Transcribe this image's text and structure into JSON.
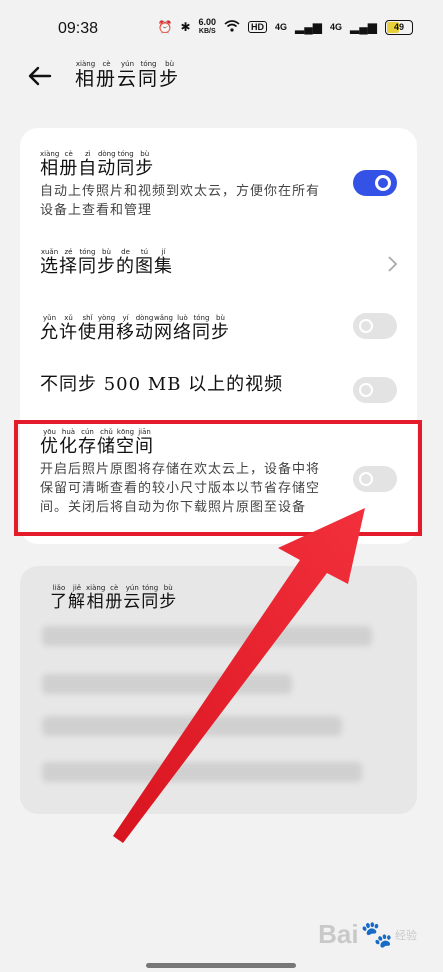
{
  "status": {
    "time": "09:38",
    "alarm_icon": "alarm-icon",
    "bluetooth_icon": "bluetooth-icon",
    "net_speed_value": "6.00",
    "net_speed_unit": "KB/S",
    "wifi_icon": "wifi-icon",
    "hd_badge": "HD",
    "signal1_label": "4G",
    "signal2_label": "4G",
    "battery_level": "49",
    "battery_fraction": 0.49
  },
  "header": {
    "back_icon": "arrow-left-icon",
    "title": "相册云同步",
    "title_pinyin": [
      "xiàng",
      "cè",
      "yún",
      "tóng",
      "bù"
    ]
  },
  "settings": [
    {
      "id": "album-auto-sync",
      "title": "相册自动同步",
      "title_pinyin": [
        "xiàng",
        "cè",
        "zì",
        "dòng",
        "tóng",
        "bù"
      ],
      "desc": "自动上传照片和视频到欢太云，方便你在所有设备上查看和管理",
      "control": "toggle",
      "on": true
    },
    {
      "id": "select-albums",
      "title": "选择同步的图集",
      "title_pinyin": [
        "xuǎn",
        "zé",
        "tóng",
        "bù",
        "de",
        "tú",
        "jí"
      ],
      "control": "chevron"
    },
    {
      "id": "mobile-data-sync",
      "title": "允许使用移动网络同步",
      "title_pinyin": [
        "yǔn",
        "xǔ",
        "shǐ",
        "yòng",
        "yí",
        "dòng",
        "wǎng",
        "luò",
        "tóng",
        "bù"
      ],
      "control": "toggle",
      "on": false
    },
    {
      "id": "skip-large-videos",
      "title": "不同步 500 MB 以上的视频",
      "control": "toggle",
      "on": false
    },
    {
      "id": "optimize-storage",
      "title": "优化存储空间",
      "title_pinyin": [
        "yōu",
        "huà",
        "cún",
        "chǔ",
        "kōng",
        "jiān"
      ],
      "desc": "开启后照片原图将存储在欢太云上，设备中将保留可清晰查看的较小尺寸版本以节省存储空间。关闭后将自动为你下载照片原图至设备",
      "control": "toggle",
      "on": false
    }
  ],
  "info": {
    "title": "了解相册云同步",
    "title_pinyin": [
      "liǎo",
      "jiě",
      "xiàng",
      "cè",
      "yún",
      "tóng",
      "bù"
    ]
  },
  "colors": {
    "accent": "#3552e6",
    "highlight": "#e31b2a",
    "background": "#f2f2f2"
  },
  "watermark": {
    "brand": "Bai",
    "paw_icon": "paw-icon",
    "brand_suffix": "经验"
  }
}
